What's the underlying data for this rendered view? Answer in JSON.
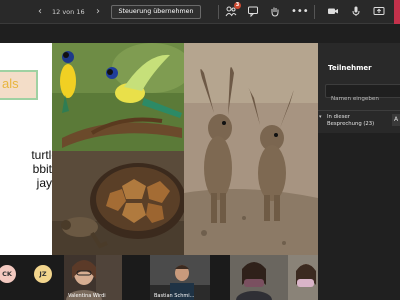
{
  "toolbar": {
    "page_counter": "12 von 16",
    "take_control": "Steuerung übernehmen",
    "participants_count": "3",
    "icons": [
      "chevron-left-icon",
      "chevron-right-icon",
      "participants-icon",
      "chat-icon",
      "raise-hand-icon",
      "more-icon",
      "camera-icon",
      "mic-icon",
      "share-icon"
    ]
  },
  "slide": {
    "title": "als",
    "list": [
      "turtle",
      "bbits",
      "jays"
    ]
  },
  "panel": {
    "title": "Teilnehmer",
    "search_placeholder": "Namen eingeben",
    "meeting_section": "In dieser Besprechung (23)",
    "bottom_text": "..."
  },
  "participants": [
    {
      "initials": "CK",
      "color": "#f3c9c0"
    },
    {
      "initials": "JZ",
      "color": "#f2d58d"
    },
    {
      "name": "Valentina Wirdi"
    },
    {
      "name": "Bastian Schmi..."
    },
    {
      "name": ""
    },
    {
      "name": ""
    }
  ],
  "colors": {
    "background": "#1f1f1f",
    "panel": "#292929",
    "leave": "#c4314b",
    "badge": "#cc4a31"
  }
}
